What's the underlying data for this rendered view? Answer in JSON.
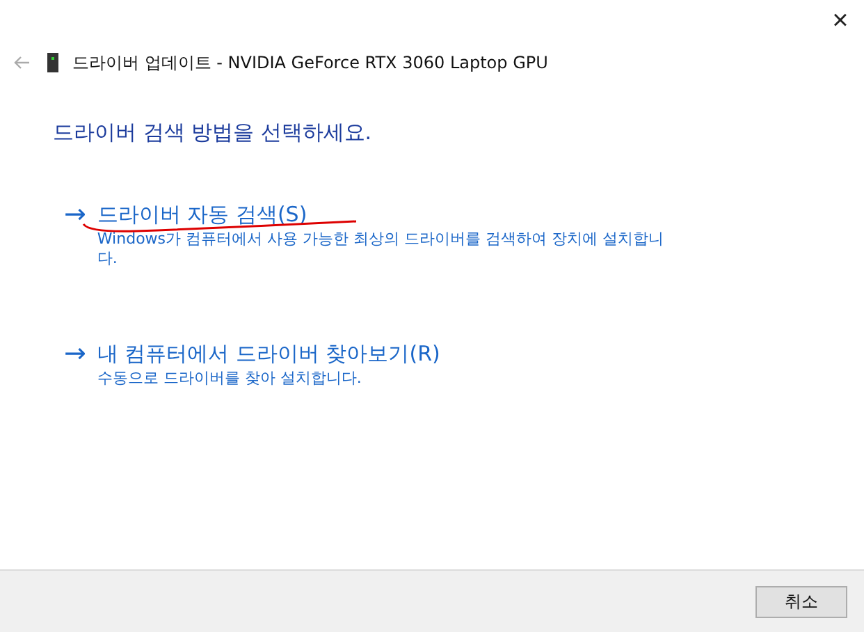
{
  "window": {
    "close": "×",
    "title": "드라이버 업데이트 - NVIDIA GeForce RTX 3060 Laptop GPU"
  },
  "heading": "드라이버 검색 방법을 선택하세요.",
  "options": [
    {
      "arrow": "→",
      "label": "드라이버 자동 검색(S)",
      "description": "Windows가 컴퓨터에서 사용 가능한 최상의 드라이버를 검색하여 장치에 설치합니다.",
      "annotated": true
    },
    {
      "arrow": "→",
      "label": "내 컴퓨터에서 드라이버 찾아보기(R)",
      "description": "수동으로 드라이버를 찾아 설치합니다.",
      "annotated": false
    }
  ],
  "buttons": [
    "취소"
  ]
}
